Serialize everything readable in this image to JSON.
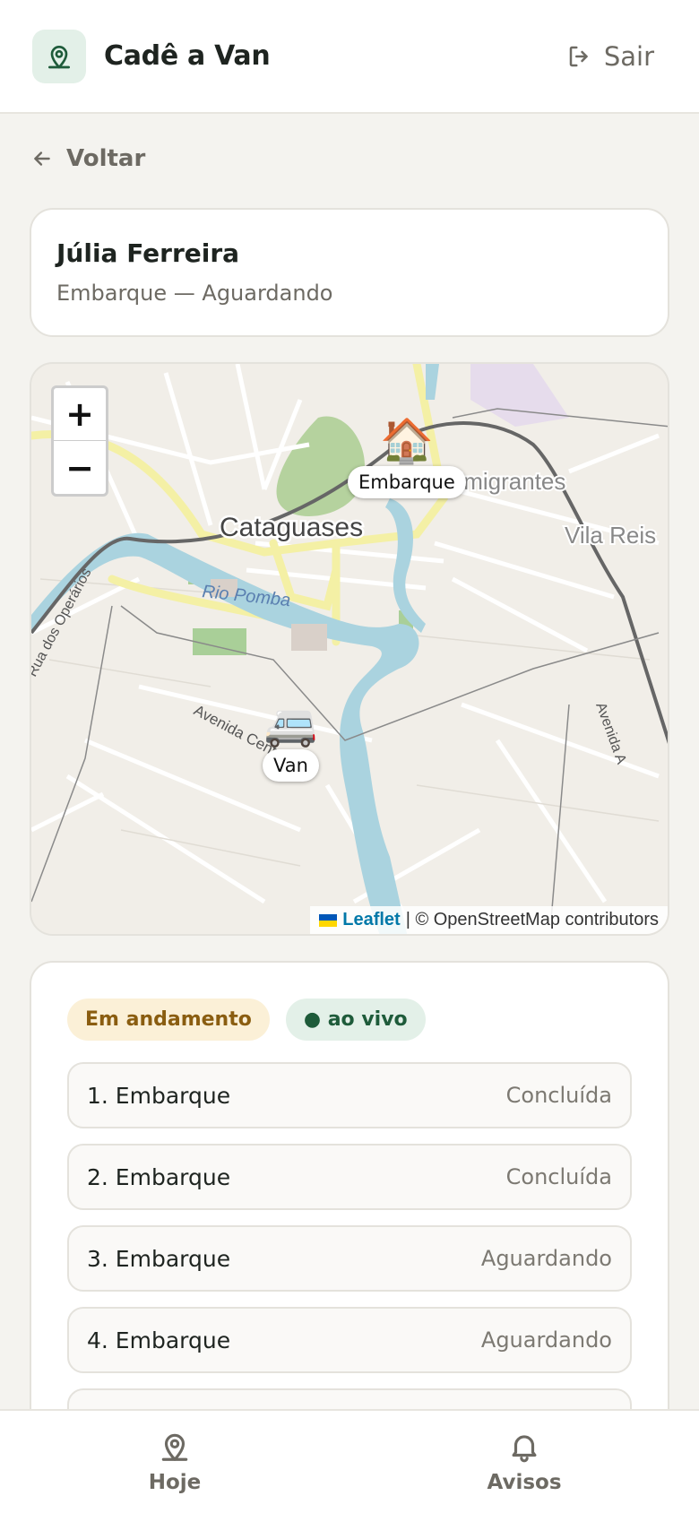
{
  "app": {
    "title": "Cadê a Van",
    "logout_label": "Sair"
  },
  "nav": {
    "back_label": "Voltar"
  },
  "person": {
    "name": "Júlia Ferreira",
    "subtitle": "Embarque — Aguardando"
  },
  "map": {
    "zoom_in": "+",
    "zoom_out": "−",
    "places": {
      "city": "Cataguases",
      "river": "Rio Pomba",
      "neighborhood_1": "Imigrantes",
      "neighborhood_2": "Vila Reis",
      "street_1": "Avenida Centenário",
      "street_2": "Rua dos Operários",
      "street_3": "Avenida A"
    },
    "markers": [
      {
        "icon": "house-icon",
        "emoji": "🏠",
        "label": "Embarque"
      },
      {
        "icon": "van-icon",
        "emoji": "🚐",
        "label": "Van"
      }
    ],
    "attribution": {
      "leaflet": "Leaflet",
      "osm": "| © OpenStreetMap contributors"
    }
  },
  "status": {
    "badges": [
      {
        "label": "Em andamento",
        "color": "#8a5d10",
        "bg": "#fbf0d7"
      },
      {
        "label": "● ao vivo",
        "color": "#1e5b3a",
        "bg": "#e3f0e8"
      }
    ],
    "stops": [
      {
        "label": "1. Embarque",
        "status": "Concluída"
      },
      {
        "label": "2. Embarque",
        "status": "Concluída"
      },
      {
        "label": "3. Embarque",
        "status": "Aguardando"
      },
      {
        "label": "4. Embarque",
        "status": "Aguardando"
      }
    ]
  },
  "bottom_nav": [
    {
      "label": "Hoje",
      "icon": "map-pin-icon"
    },
    {
      "label": "Avisos",
      "icon": "bell-icon"
    }
  ],
  "colors": {
    "accent": "#1e5b3a",
    "background": "#f4f3ef",
    "river": "#aad3df"
  }
}
